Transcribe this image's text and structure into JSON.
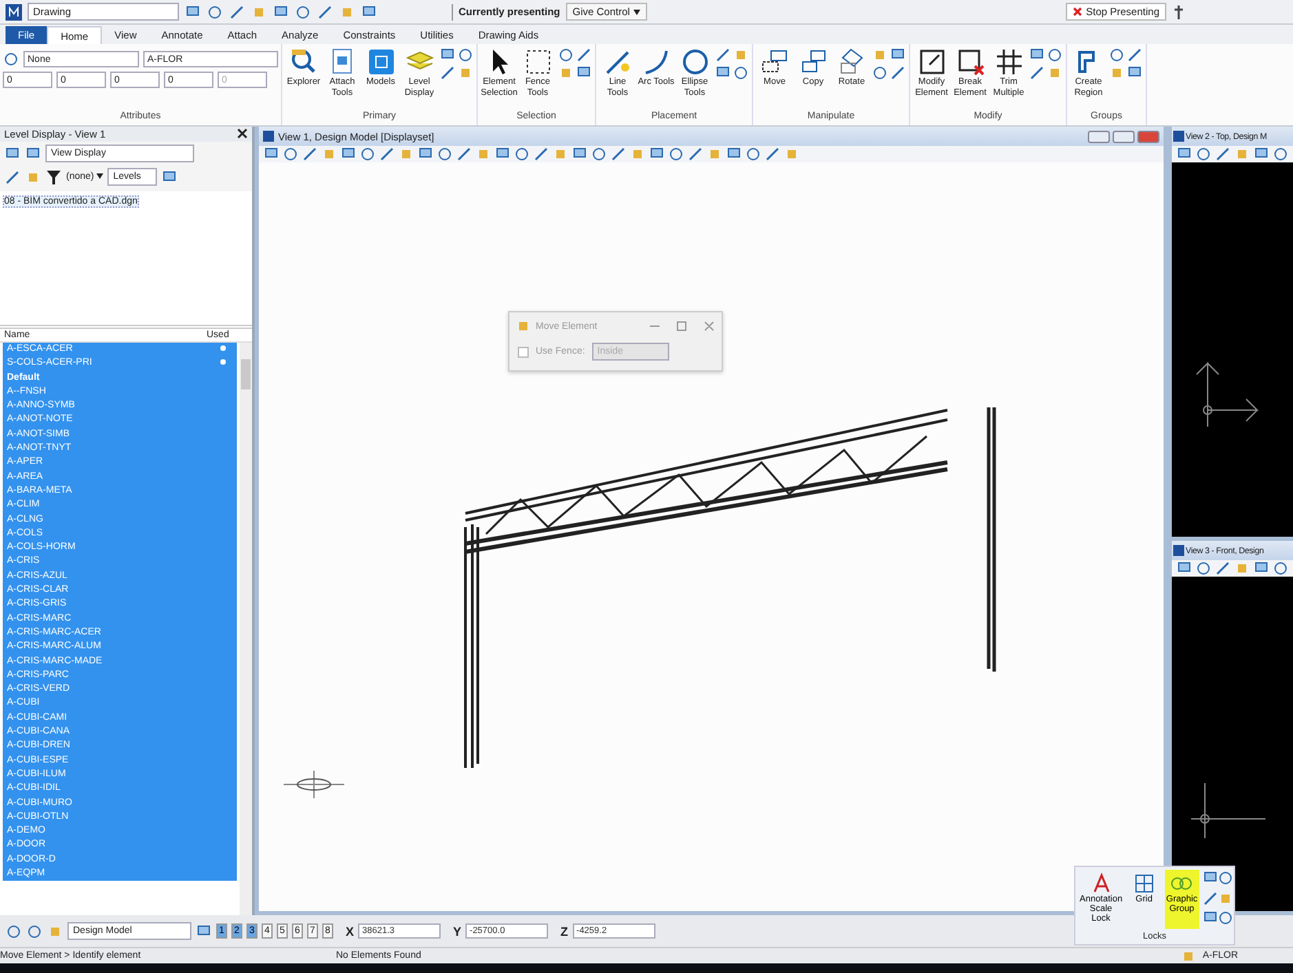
{
  "title_bar": {
    "file": "Drawing",
    "presenting": "Currently presenting",
    "give_control": "Give Control",
    "stop": "Stop Presenting"
  },
  "ribbon": {
    "tabs": [
      {
        "label": "File",
        "kind": "file",
        "selected": false
      },
      {
        "label": "Home",
        "kind": "tab",
        "selected": true
      },
      {
        "label": "View",
        "kind": "tab",
        "selected": false
      },
      {
        "label": "Annotate",
        "kind": "tab",
        "selected": false
      },
      {
        "label": "Attach",
        "kind": "tab",
        "selected": false
      },
      {
        "label": "Analyze",
        "kind": "tab",
        "selected": false
      },
      {
        "label": "Constraints",
        "kind": "tab",
        "selected": false
      },
      {
        "label": "Utilities",
        "kind": "tab",
        "selected": false
      },
      {
        "label": "Drawing Aids",
        "kind": "tab",
        "selected": false
      }
    ],
    "attributes": {
      "label": "Attributes",
      "active_style": "None",
      "active_level": "A-FLOR",
      "settings": [
        {
          "value": "0",
          "disabled": false
        },
        {
          "value": "0",
          "disabled": false
        },
        {
          "value": "0",
          "disabled": false
        },
        {
          "value": "0",
          "disabled": false
        },
        {
          "value": "0",
          "disabled": true
        }
      ]
    },
    "groups": [
      {
        "label": "Primary",
        "tools": [
          "Explorer",
          "Attach Tools",
          "Models",
          "Level Display"
        ]
      },
      {
        "label": "Selection",
        "tools": [
          "Element Selection",
          "Fence Tools"
        ]
      },
      {
        "label": "Placement",
        "tools": [
          "Line Tools",
          "Arc Tools",
          "Ellipse Tools"
        ]
      },
      {
        "label": "Manipulate",
        "tools": [
          "Move",
          "Copy",
          "Rotate"
        ]
      },
      {
        "label": "Modify",
        "tools": [
          "Modify Element",
          "Break Element",
          "Trim Multiple"
        ]
      },
      {
        "label": "Groups",
        "tools": [
          "Create Region"
        ]
      }
    ]
  },
  "level_panel": {
    "title": "Level Display - View 1",
    "display_mode": "View Display",
    "filter": "(none)",
    "list_mode": "Levels",
    "file": "08 - BIM convertido a CAD.dgn",
    "columns": [
      "Name",
      "Used"
    ],
    "levels": [
      {
        "name": "A-ESCA-ACER",
        "used": true,
        "active": false,
        "selected": true
      },
      {
        "name": "S-COLS-ACER-PRI",
        "used": true,
        "active": false,
        "selected": true
      },
      {
        "name": "Default",
        "used": false,
        "active": true,
        "selected": true
      },
      {
        "name": "A--FNSH",
        "used": false,
        "active": false,
        "selected": true
      },
      {
        "name": "A-ANNO-SYMB",
        "used": false,
        "active": false,
        "selected": true
      },
      {
        "name": "A-ANOT-NOTE",
        "used": false,
        "active": false,
        "selected": true
      },
      {
        "name": "A-ANOT-SIMB",
        "used": false,
        "active": false,
        "selected": true
      },
      {
        "name": "A-ANOT-TNYT",
        "used": false,
        "active": false,
        "selected": true
      },
      {
        "name": "A-APER",
        "used": false,
        "active": false,
        "selected": true
      },
      {
        "name": "A-AREA",
        "used": false,
        "active": false,
        "selected": true
      },
      {
        "name": "A-BARA-META",
        "used": false,
        "active": false,
        "selected": true
      },
      {
        "name": "A-CLIM",
        "used": false,
        "active": false,
        "selected": true
      },
      {
        "name": "A-CLNG",
        "used": false,
        "active": false,
        "selected": true
      },
      {
        "name": "A-COLS",
        "used": false,
        "active": false,
        "selected": true
      },
      {
        "name": "A-COLS-HORM",
        "used": false,
        "active": false,
        "selected": true
      },
      {
        "name": "A-CRIS",
        "used": false,
        "active": false,
        "selected": true
      },
      {
        "name": "A-CRIS-AZUL",
        "used": false,
        "active": false,
        "selected": true
      },
      {
        "name": "A-CRIS-CLAR",
        "used": false,
        "active": false,
        "selected": true
      },
      {
        "name": "A-CRIS-GRIS",
        "used": false,
        "active": false,
        "selected": true
      },
      {
        "name": "A-CRIS-MARC",
        "used": false,
        "active": false,
        "selected": true
      },
      {
        "name": "A-CRIS-MARC-ACER",
        "used": false,
        "active": false,
        "selected": true
      },
      {
        "name": "A-CRIS-MARC-ALUM",
        "used": false,
        "active": false,
        "selected": true
      },
      {
        "name": "A-CRIS-MARC-MADE",
        "used": false,
        "active": false,
        "selected": true
      },
      {
        "name": "A-CRIS-PARC",
        "used": false,
        "active": false,
        "selected": true
      },
      {
        "name": "A-CRIS-VERD",
        "used": false,
        "active": false,
        "selected": true
      },
      {
        "name": "A-CUBI",
        "used": false,
        "active": false,
        "selected": true
      },
      {
        "name": "A-CUBI-CAMI",
        "used": false,
        "active": false,
        "selected": true
      },
      {
        "name": "A-CUBI-CANA",
        "used": false,
        "active": false,
        "selected": true
      },
      {
        "name": "A-CUBI-DREN",
        "used": false,
        "active": false,
        "selected": true
      },
      {
        "name": "A-CUBI-ESPE",
        "used": false,
        "active": false,
        "selected": true
      },
      {
        "name": "A-CUBI-ILUM",
        "used": false,
        "active": false,
        "selected": true
      },
      {
        "name": "A-CUBI-IDIL",
        "used": false,
        "active": false,
        "selected": true
      },
      {
        "name": "A-CUBI-MURO",
        "used": false,
        "active": false,
        "selected": true
      },
      {
        "name": "A-CUBI-OTLN",
        "used": false,
        "active": false,
        "selected": true
      },
      {
        "name": "A-DEMO",
        "used": false,
        "active": false,
        "selected": true
      },
      {
        "name": "A-DOOR",
        "used": false,
        "active": false,
        "selected": true
      },
      {
        "name": "A-DOOR-D",
        "used": false,
        "active": false,
        "selected": true
      },
      {
        "name": "A-EQPM",
        "used": false,
        "active": false,
        "selected": true
      }
    ]
  },
  "main_view": {
    "title": "View 1, Design Model [Displayset]"
  },
  "dialog": {
    "title": "Move Element",
    "use_fence_label": "Use Fence:",
    "fence_mode": "Inside",
    "checked": false
  },
  "side_views": [
    {
      "title": "View 2 - Top, Design M"
    },
    {
      "title": "View 3 - Front, Design"
    }
  ],
  "bottom_bar": {
    "model": "Design Model",
    "view_buttons": [
      {
        "label": "1",
        "selected": true
      },
      {
        "label": "2",
        "selected": true
      },
      {
        "label": "3",
        "selected": true
      },
      {
        "label": "4",
        "selected": false
      },
      {
        "label": "5",
        "selected": false
      },
      {
        "label": "6",
        "selected": false
      },
      {
        "label": "7",
        "selected": false
      },
      {
        "label": "8",
        "selected": false
      }
    ],
    "coords": [
      {
        "axis": "X",
        "value": "38621.3"
      },
      {
        "axis": "Y",
        "value": "-25700.0"
      },
      {
        "axis": "Z",
        "value": "-4259.2"
      }
    ]
  },
  "locks": {
    "label": "Locks",
    "items": [
      {
        "label": "Annotation Scale Lock",
        "kind": "annotation",
        "on": false
      },
      {
        "label": "Grid",
        "kind": "grid",
        "on": false
      },
      {
        "label": "Graphic Group",
        "kind": "group",
        "on": true
      }
    ]
  },
  "status_bar": {
    "prompt": "Move Element > Identify element",
    "message": "No Elements Found",
    "level": "A-FLOR"
  }
}
